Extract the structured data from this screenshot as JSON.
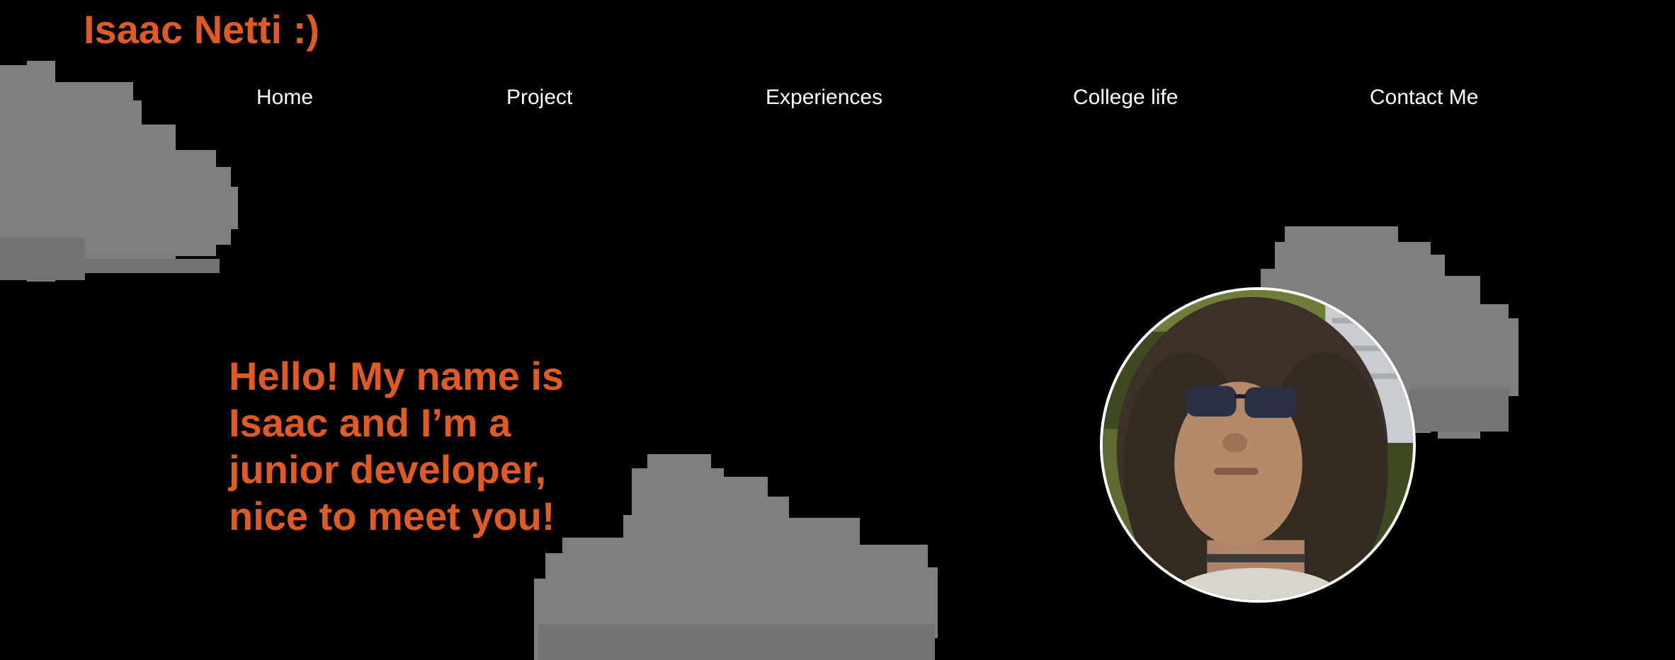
{
  "header": {
    "site_title": "Isaac Netti :)"
  },
  "nav": {
    "items": [
      {
        "label": "Home"
      },
      {
        "label": "Project"
      },
      {
        "label": "Experiences"
      },
      {
        "label": "College life"
      },
      {
        "label": "Contact Me"
      }
    ]
  },
  "hero": {
    "greeting": "Hello! My name is Isaac and I’m a junior developer, nice to meet you!"
  },
  "profile": {
    "avatar_icon": "profile-photo"
  },
  "decorations": {
    "cloud_icon": "pixel-cloud-icon"
  },
  "colors": {
    "background": "#000000",
    "accent": "#e05a24",
    "nav_text": "#ffffff",
    "cloud": "#7d7d7d"
  }
}
